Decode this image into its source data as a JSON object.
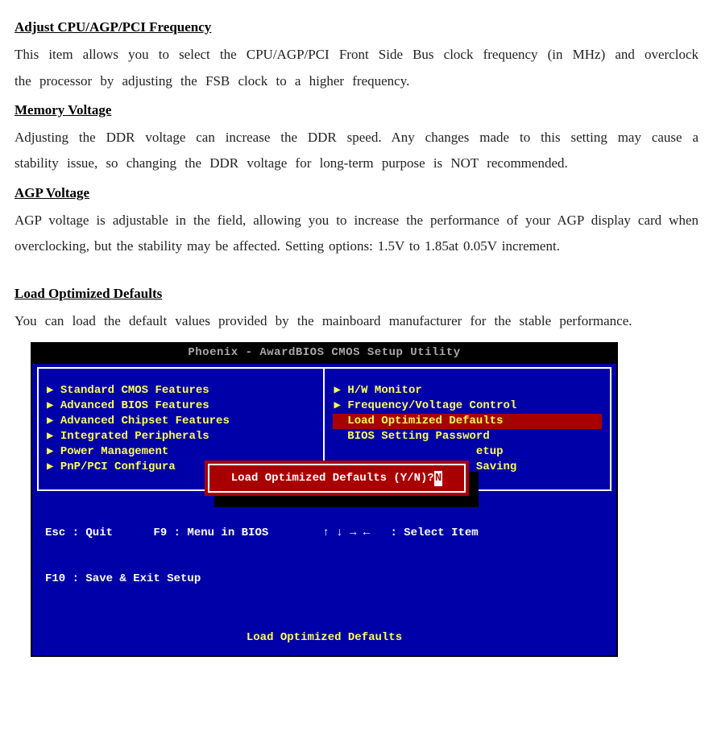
{
  "sections": {
    "s1_head": "Adjust CPU/AGP/PCI Frequency",
    "s1_body": "This item allows you to select the CPU/AGP/PCI Front Side Bus clock frequency (in MHz) and overclock the processor by adjusting the FSB clock to a higher frequency.",
    "s2_head": "Memory Voltage",
    "s2_body": "Adjusting the DDR voltage can increase the DDR speed.  Any changes made to this setting may cause a stability issue, so changing the DDR voltage for long-term purpose is NOT recommended.",
    "s3_head": "AGP Voltage",
    "s3_body": "AGP voltage is adjustable in the field, allowing you to increase the performance of your AGP display card when overclocking, but the stability may be affected. Setting options: 1.5V to 1.85at 0.05V increment.",
    "s4_head": "Load Optimized Defaults",
    "s4_body": "You can load the default values provided by the mainboard manufacturer for the stable performance."
  },
  "bios": {
    "title": "Phoenix - AwardBIOS CMOS Setup Utility",
    "left_items": [
      "▶ Standard CMOS Features",
      "▶ Advanced BIOS Features",
      "▶ Advanced Chipset Features",
      "▶ Integrated Peripherals",
      "▶ Power Management",
      "▶ PnP/PCI Configura"
    ],
    "right_items": [
      {
        "label": "▶ H/W Monitor",
        "selected": false,
        "arrow": true
      },
      {
        "label": "▶ Frequency/Voltage Control",
        "selected": false,
        "arrow": true
      },
      {
        "label": "  Load Optimized Defaults",
        "selected": true,
        "arrow": false
      },
      {
        "label": "  BIOS Setting Password",
        "selected": false,
        "arrow": false
      },
      {
        "label": "                     etup",
        "selected": false,
        "arrow": false
      },
      {
        "label": "                     Saving",
        "selected": false,
        "arrow": false
      }
    ],
    "modal_text": "Load Optimized Defaults (Y/N)? ",
    "modal_answer": "N",
    "keys_line1": "Esc : Quit      F9 : Menu in BIOS        ↑ ↓ → ←   : Select Item",
    "keys_line2": "F10 : Save & Exit Setup",
    "footer": "Load Optimized Defaults"
  }
}
